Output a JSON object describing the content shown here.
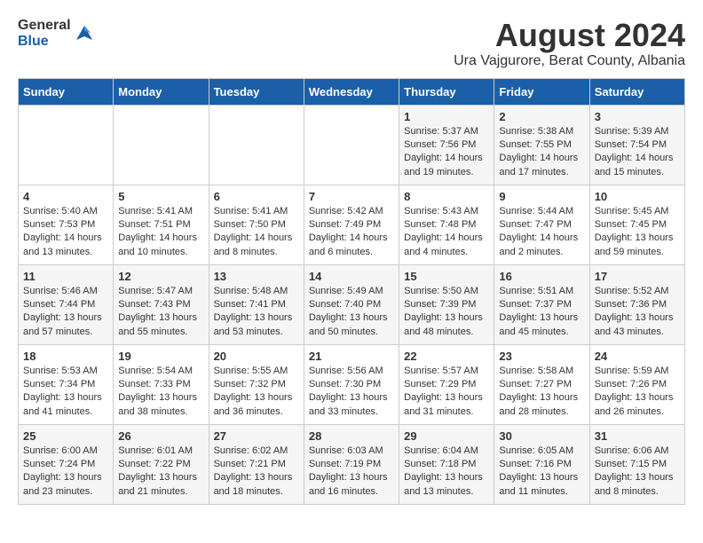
{
  "header": {
    "logo_general": "General",
    "logo_blue": "Blue",
    "month_title": "August 2024",
    "location": "Ura Vajgurore, Berat County, Albania"
  },
  "weekdays": [
    "Sunday",
    "Monday",
    "Tuesday",
    "Wednesday",
    "Thursday",
    "Friday",
    "Saturday"
  ],
  "weeks": [
    [
      {
        "day": "",
        "sunrise": "",
        "sunset": "",
        "daylight": ""
      },
      {
        "day": "",
        "sunrise": "",
        "sunset": "",
        "daylight": ""
      },
      {
        "day": "",
        "sunrise": "",
        "sunset": "",
        "daylight": ""
      },
      {
        "day": "",
        "sunrise": "",
        "sunset": "",
        "daylight": ""
      },
      {
        "day": "1",
        "sunrise": "Sunrise: 5:37 AM",
        "sunset": "Sunset: 7:56 PM",
        "daylight": "Daylight: 14 hours and 19 minutes."
      },
      {
        "day": "2",
        "sunrise": "Sunrise: 5:38 AM",
        "sunset": "Sunset: 7:55 PM",
        "daylight": "Daylight: 14 hours and 17 minutes."
      },
      {
        "day": "3",
        "sunrise": "Sunrise: 5:39 AM",
        "sunset": "Sunset: 7:54 PM",
        "daylight": "Daylight: 14 hours and 15 minutes."
      }
    ],
    [
      {
        "day": "4",
        "sunrise": "Sunrise: 5:40 AM",
        "sunset": "Sunset: 7:53 PM",
        "daylight": "Daylight: 14 hours and 13 minutes."
      },
      {
        "day": "5",
        "sunrise": "Sunrise: 5:41 AM",
        "sunset": "Sunset: 7:51 PM",
        "daylight": "Daylight: 14 hours and 10 minutes."
      },
      {
        "day": "6",
        "sunrise": "Sunrise: 5:41 AM",
        "sunset": "Sunset: 7:50 PM",
        "daylight": "Daylight: 14 hours and 8 minutes."
      },
      {
        "day": "7",
        "sunrise": "Sunrise: 5:42 AM",
        "sunset": "Sunset: 7:49 PM",
        "daylight": "Daylight: 14 hours and 6 minutes."
      },
      {
        "day": "8",
        "sunrise": "Sunrise: 5:43 AM",
        "sunset": "Sunset: 7:48 PM",
        "daylight": "Daylight: 14 hours and 4 minutes."
      },
      {
        "day": "9",
        "sunrise": "Sunrise: 5:44 AM",
        "sunset": "Sunset: 7:47 PM",
        "daylight": "Daylight: 14 hours and 2 minutes."
      },
      {
        "day": "10",
        "sunrise": "Sunrise: 5:45 AM",
        "sunset": "Sunset: 7:45 PM",
        "daylight": "Daylight: 13 hours and 59 minutes."
      }
    ],
    [
      {
        "day": "11",
        "sunrise": "Sunrise: 5:46 AM",
        "sunset": "Sunset: 7:44 PM",
        "daylight": "Daylight: 13 hours and 57 minutes."
      },
      {
        "day": "12",
        "sunrise": "Sunrise: 5:47 AM",
        "sunset": "Sunset: 7:43 PM",
        "daylight": "Daylight: 13 hours and 55 minutes."
      },
      {
        "day": "13",
        "sunrise": "Sunrise: 5:48 AM",
        "sunset": "Sunset: 7:41 PM",
        "daylight": "Daylight: 13 hours and 53 minutes."
      },
      {
        "day": "14",
        "sunrise": "Sunrise: 5:49 AM",
        "sunset": "Sunset: 7:40 PM",
        "daylight": "Daylight: 13 hours and 50 minutes."
      },
      {
        "day": "15",
        "sunrise": "Sunrise: 5:50 AM",
        "sunset": "Sunset: 7:39 PM",
        "daylight": "Daylight: 13 hours and 48 minutes."
      },
      {
        "day": "16",
        "sunrise": "Sunrise: 5:51 AM",
        "sunset": "Sunset: 7:37 PM",
        "daylight": "Daylight: 13 hours and 45 minutes."
      },
      {
        "day": "17",
        "sunrise": "Sunrise: 5:52 AM",
        "sunset": "Sunset: 7:36 PM",
        "daylight": "Daylight: 13 hours and 43 minutes."
      }
    ],
    [
      {
        "day": "18",
        "sunrise": "Sunrise: 5:53 AM",
        "sunset": "Sunset: 7:34 PM",
        "daylight": "Daylight: 13 hours and 41 minutes."
      },
      {
        "day": "19",
        "sunrise": "Sunrise: 5:54 AM",
        "sunset": "Sunset: 7:33 PM",
        "daylight": "Daylight: 13 hours and 38 minutes."
      },
      {
        "day": "20",
        "sunrise": "Sunrise: 5:55 AM",
        "sunset": "Sunset: 7:32 PM",
        "daylight": "Daylight: 13 hours and 36 minutes."
      },
      {
        "day": "21",
        "sunrise": "Sunrise: 5:56 AM",
        "sunset": "Sunset: 7:30 PM",
        "daylight": "Daylight: 13 hours and 33 minutes."
      },
      {
        "day": "22",
        "sunrise": "Sunrise: 5:57 AM",
        "sunset": "Sunset: 7:29 PM",
        "daylight": "Daylight: 13 hours and 31 minutes."
      },
      {
        "day": "23",
        "sunrise": "Sunrise: 5:58 AM",
        "sunset": "Sunset: 7:27 PM",
        "daylight": "Daylight: 13 hours and 28 minutes."
      },
      {
        "day": "24",
        "sunrise": "Sunrise: 5:59 AM",
        "sunset": "Sunset: 7:26 PM",
        "daylight": "Daylight: 13 hours and 26 minutes."
      }
    ],
    [
      {
        "day": "25",
        "sunrise": "Sunrise: 6:00 AM",
        "sunset": "Sunset: 7:24 PM",
        "daylight": "Daylight: 13 hours and 23 minutes."
      },
      {
        "day": "26",
        "sunrise": "Sunrise: 6:01 AM",
        "sunset": "Sunset: 7:22 PM",
        "daylight": "Daylight: 13 hours and 21 minutes."
      },
      {
        "day": "27",
        "sunrise": "Sunrise: 6:02 AM",
        "sunset": "Sunset: 7:21 PM",
        "daylight": "Daylight: 13 hours and 18 minutes."
      },
      {
        "day": "28",
        "sunrise": "Sunrise: 6:03 AM",
        "sunset": "Sunset: 7:19 PM",
        "daylight": "Daylight: 13 hours and 16 minutes."
      },
      {
        "day": "29",
        "sunrise": "Sunrise: 6:04 AM",
        "sunset": "Sunset: 7:18 PM",
        "daylight": "Daylight: 13 hours and 13 minutes."
      },
      {
        "day": "30",
        "sunrise": "Sunrise: 6:05 AM",
        "sunset": "Sunset: 7:16 PM",
        "daylight": "Daylight: 13 hours and 11 minutes."
      },
      {
        "day": "31",
        "sunrise": "Sunrise: 6:06 AM",
        "sunset": "Sunset: 7:15 PM",
        "daylight": "Daylight: 13 hours and 8 minutes."
      }
    ]
  ]
}
